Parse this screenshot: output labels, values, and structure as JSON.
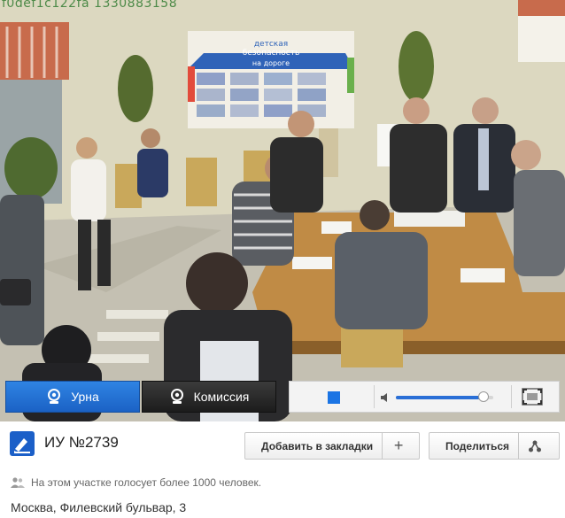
{
  "video": {
    "stream_id": "f0def1c122fa 1330883158",
    "poster": {
      "line1": "детская",
      "line2": "безопасность",
      "line3": "на дороге"
    }
  },
  "controls": {
    "urna_label": "Урна",
    "komissiya_label": "Комиссия",
    "active_camera": "Урна",
    "volume_level": 0.9,
    "accent_color": "#1f6fd6"
  },
  "station": {
    "title": "ИУ №2739",
    "bookmark_label": "Добавить в закладки",
    "bookmark_addon_icon": "plus-icon",
    "share_label": "Поделиться",
    "share_addon_icon": "share-icon",
    "voters_text": "На этом участке голосует более 1000 человек.",
    "address": "Москва, Филевский бульвар, 3"
  }
}
